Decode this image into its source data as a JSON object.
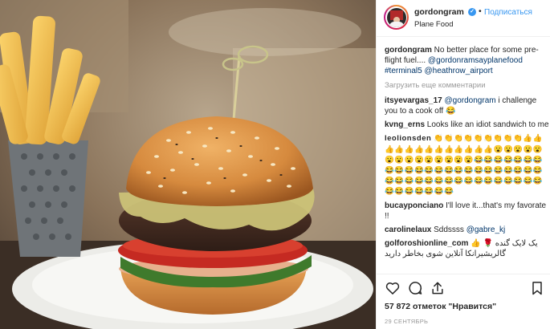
{
  "header": {
    "username": "gordongram",
    "verified_icon": "verified-badge-icon",
    "separator": "•",
    "follow_label": "Подписаться",
    "location": "Plane Food"
  },
  "caption": {
    "username": "gordongram",
    "text": "No better place for some pre-flight fuel.... ",
    "mention_1": "@gordonramsayplanefood",
    "tag_1": "#terminal5",
    "mention_2": "@heathrow_airport"
  },
  "load_more": "Загрузить еще комментарии",
  "comments": [
    {
      "user": "itsyevargas_17",
      "mention": "@gordongram",
      "text": " i challenge you to a cook off 😂"
    },
    {
      "user": "kvng_erns",
      "text": " Looks like an idiot sandwich to me"
    },
    {
      "user": "leolionsden",
      "text": " 👏👏👏👏👏👏👏👏👏👍👍👍👍👍👍👍👍👍👍👍👍👍😮😮😮😮😮😮😮😮😮😮😮😮😮😮😂😂😂😂😂😂😂😂😂😂😂😂😂😂😂😂😂😂😂😂😂😂😂😂😂😂😂😂😂😂😂😂😂😂😂😂😂😂😂😂😂😂😂😂😂😂"
    },
    {
      "user": "bucayponciano",
      "text": " I'll love it...that's my favorate !!"
    },
    {
      "user": "carolinelaux",
      "text": " Sddssss ",
      "mention": "@gabre_kj"
    },
    {
      "user": "golforoshionline_com",
      "text": " 👍 یک لایک گنده 🌹 گالریشیرانکا آنلاین شوی بخاطر دارید"
    }
  ],
  "actions": {
    "like": "heart-outline-icon",
    "comment": "comment-bubble-icon",
    "share": "share-arrow-icon",
    "save": "bookmark-icon"
  },
  "likes_text": "57 872 отметок \"Нравится\"",
  "date": "29 СЕНТЯБРЬ",
  "colors": {
    "link": "#003569",
    "follow": "#3897f0",
    "muted": "#999999",
    "verified": "#3897f0"
  }
}
